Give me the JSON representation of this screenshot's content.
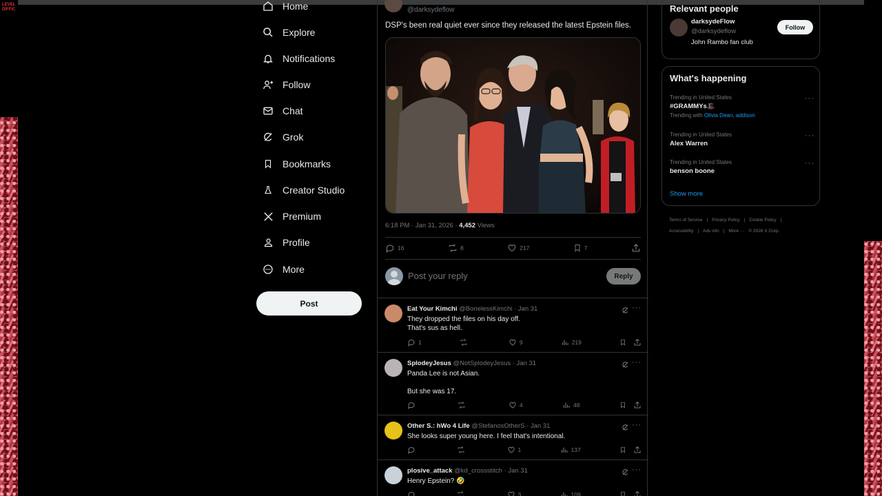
{
  "corner_label": [
    "LEVEL",
    "DIFFIC"
  ],
  "nav": {
    "items": [
      {
        "id": "home",
        "label": "Home",
        "icon": "home-icon"
      },
      {
        "id": "explore",
        "label": "Explore",
        "icon": "search-icon"
      },
      {
        "id": "notifications",
        "label": "Notifications",
        "icon": "bell-icon"
      },
      {
        "id": "follow",
        "label": "Follow",
        "icon": "person-add-icon"
      },
      {
        "id": "chat",
        "label": "Chat",
        "icon": "mail-icon"
      },
      {
        "id": "grok",
        "label": "Grok",
        "icon": "grok-icon"
      },
      {
        "id": "bookmarks",
        "label": "Bookmarks",
        "icon": "bookmark-icon"
      },
      {
        "id": "creator-studio",
        "label": "Creator Studio",
        "icon": "flask-icon"
      },
      {
        "id": "premium",
        "label": "Premium",
        "icon": "x-logo-icon"
      },
      {
        "id": "profile",
        "label": "Profile",
        "icon": "person-icon"
      },
      {
        "id": "more",
        "label": "More",
        "icon": "more-circle-icon"
      }
    ],
    "post_label": "Post"
  },
  "tweet": {
    "handle": "@darksydeflow",
    "text": "DSP's been real quiet ever since they released the latest Epstein files.",
    "time": "6:18 PM · Jan 31, 2026 · ",
    "views_count": "4,452",
    "views_label": " Views",
    "stats": {
      "replies": "16",
      "reposts": "8",
      "likes": "217",
      "bookmarks": "7"
    }
  },
  "reply_composer": {
    "placeholder": "Post your reply",
    "button": "Reply"
  },
  "replies": [
    {
      "name": "Eat Your Kimchi",
      "handle": "@BonelessKimchi · Jan 31",
      "body": "They dropped the files on his day off.\nThat's sus as hell.",
      "replies": "1",
      "reposts": "",
      "likes": "9",
      "views": "219",
      "avatar_color": "#c98a6a"
    },
    {
      "name": "SplodeyJesus",
      "handle": "@NotSplodeyJesus · Jan 31",
      "body": "Panda Lee is not Asian.\n\nBut she was 17.",
      "replies": "",
      "reposts": "",
      "likes": "4",
      "views": "48",
      "avatar_color": "#b9b3b8"
    },
    {
      "name": "Other S.: hWo 4 Life",
      "handle": "@StefanosOtherS · Jan 31",
      "body": "She looks super young here. I feel that's intentional.",
      "replies": "",
      "reposts": "",
      "likes": "1",
      "views": "137",
      "avatar_color": "#e6c21a"
    },
    {
      "name": "plosive_attack",
      "handle": "@kd_crossstitch · Jan 31",
      "body": "Henry Epstein? 🤣",
      "replies": "",
      "reposts": "",
      "likes": "3",
      "views": "109",
      "avatar_color": "#c8d2d8"
    }
  ],
  "relevant_people": {
    "title": "Relevant people",
    "name": "darksydeFlow",
    "handle": "@darksydeflow",
    "bio": "John Rambo fan club",
    "follow_label": "Follow"
  },
  "whats_happening": {
    "title": "What's happening",
    "trends": [
      {
        "context": "Trending in United States",
        "topic": "#GRAMMYs🎩",
        "with_prefix": "Trending with ",
        "with_links": "Olivia Dean, addison"
      },
      {
        "context": "Trending in United States",
        "topic": "Alex Warren",
        "with_prefix": "",
        "with_links": ""
      },
      {
        "context": "Trending in United States",
        "topic": "benson boone",
        "with_prefix": "",
        "with_links": ""
      }
    ],
    "show_more": "Show more"
  },
  "footer": {
    "links": [
      "Terms of Service",
      "|",
      "Privacy Policy",
      "|",
      "Cookie Policy",
      "|",
      "Accessibility",
      "|",
      "Ads info",
      "|",
      "More ···",
      "© 2026 X Corp."
    ]
  },
  "colors": {
    "accent": "#1d9bf0",
    "border": "#2f3336",
    "muted": "#71767b",
    "text": "#e7e9ea"
  }
}
